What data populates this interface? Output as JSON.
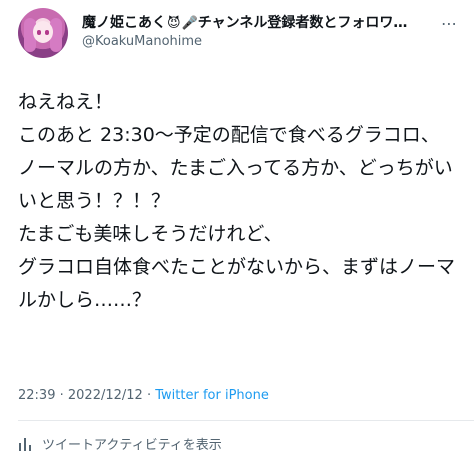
{
  "user": {
    "display_name": "魔ノ姫こあく",
    "name_suffix": "チャンネル登録者数とフォロワ…",
    "handle": "@KoakuManohime",
    "name_icons": [
      "devil-emoji-icon",
      "microphone-emoji-icon"
    ]
  },
  "tweet": {
    "text": "ねえねえ！\nこのあと 23:30〜予定の配信で食べるグラコロ、\nノーマルの方か、たまご入ってる方か、どっちがいいと思う！？！？\nたまごも美味しそうだけれど、\nグラコロ自体食べたことがないから、まずはノーマルかしら……？",
    "time": "22:39",
    "date": "2022/12/12",
    "separator": "·",
    "source": "Twitter for iPhone"
  },
  "activity": {
    "label": "ツイートアクティビティを表示",
    "icon": "analytics-icon"
  },
  "colors": {
    "link": "#1d9bf0",
    "secondary_text": "#536471"
  }
}
